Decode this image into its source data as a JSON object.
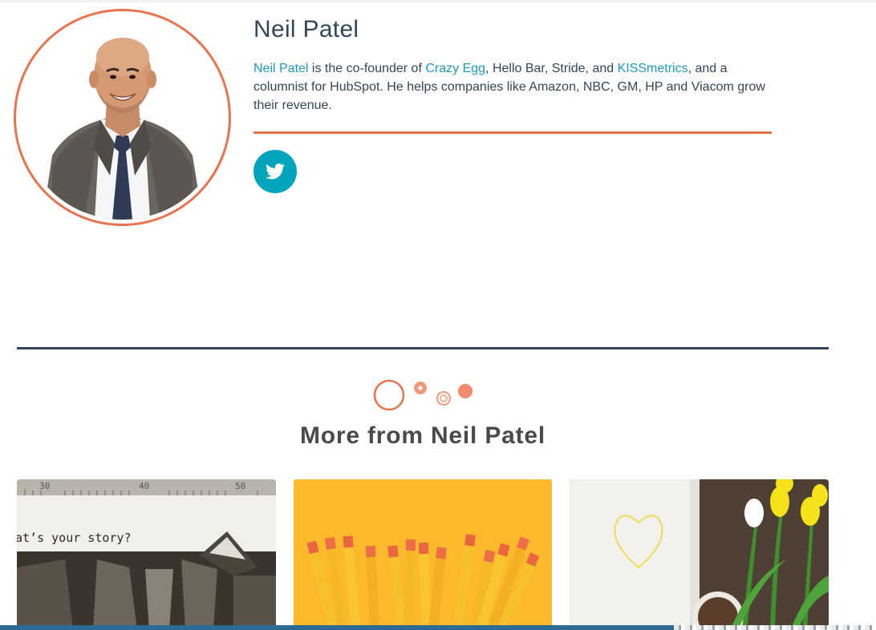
{
  "author": {
    "name": "Neil Patel",
    "bio": {
      "link_name": "Neil Patel",
      "text_1": " is the co-founder of ",
      "link_crazy_egg": "Crazy Egg",
      "text_2": ", Hello Bar, Stride, and ",
      "link_kissmetrics": "KISSmetrics",
      "text_3": ", and a columnist for HubSpot. He helps companies like Amazon, NBC, GM, HP and Viacom grow their revenue."
    },
    "social": {
      "icon": "twitter-icon",
      "color": "#00a4bd"
    }
  },
  "more_section": {
    "heading": "More from Neil Patel",
    "cards": [
      {
        "image": "typewriter-story-image",
        "image_text": "at’s your story?",
        "ruler_text": "30 40 50"
      },
      {
        "image": "yellow-pencils-image"
      },
      {
        "image": "heart-notebook-tulips-image"
      }
    ]
  },
  "colors": {
    "accent_orange": "#e8744f",
    "link_blue": "#1a9cbf",
    "text_dark": "#33475b",
    "twitter_teal": "#00a4bd"
  }
}
